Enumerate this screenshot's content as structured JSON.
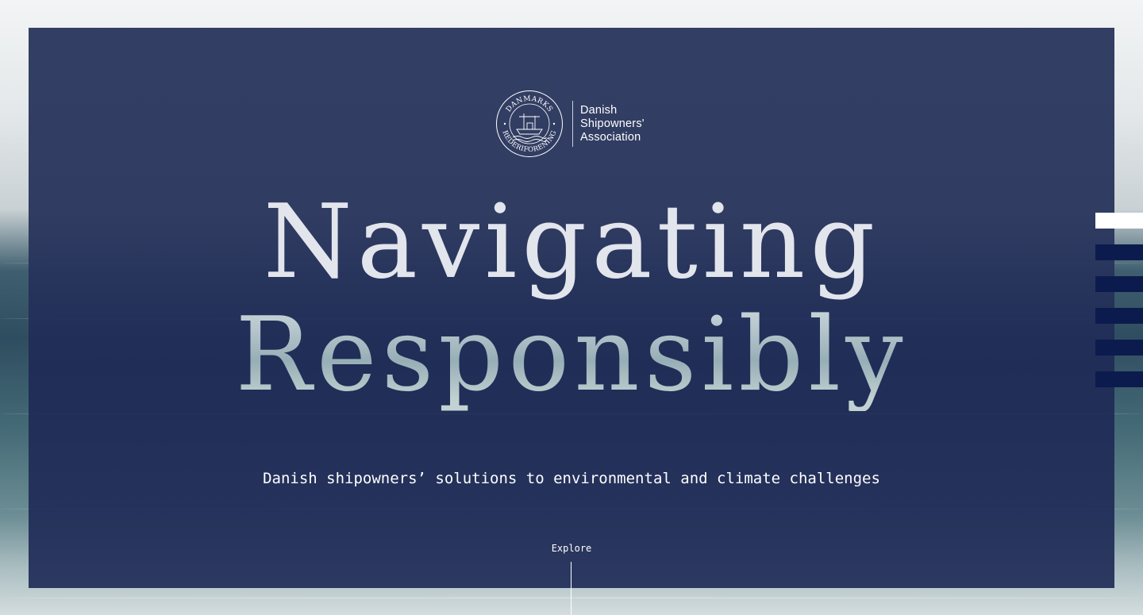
{
  "logo": {
    "seal_text_top": "DANMARKS",
    "seal_text_bottom": "REDERIFORENING",
    "name_line1": "Danish",
    "name_line2": "Shipowners'",
    "name_line3": "Association"
  },
  "hero": {
    "title_line1": "Navigating",
    "title_line2": "Responsibly",
    "subtitle": "Danish shipowners’ solutions to environmental and climate challenges"
  },
  "explore": {
    "label": "Explore"
  },
  "sidenav": {
    "items": [
      {
        "state": "active"
      },
      {
        "state": "inactive"
      },
      {
        "state": "inactive"
      },
      {
        "state": "inactive"
      },
      {
        "state": "inactive"
      },
      {
        "state": "inactive"
      }
    ]
  },
  "colors": {
    "panel_navy": "#28345c",
    "nav_bar_navy": "#0c1b4d",
    "nav_bar_active": "#ffffff",
    "text_white": "#ffffff"
  }
}
